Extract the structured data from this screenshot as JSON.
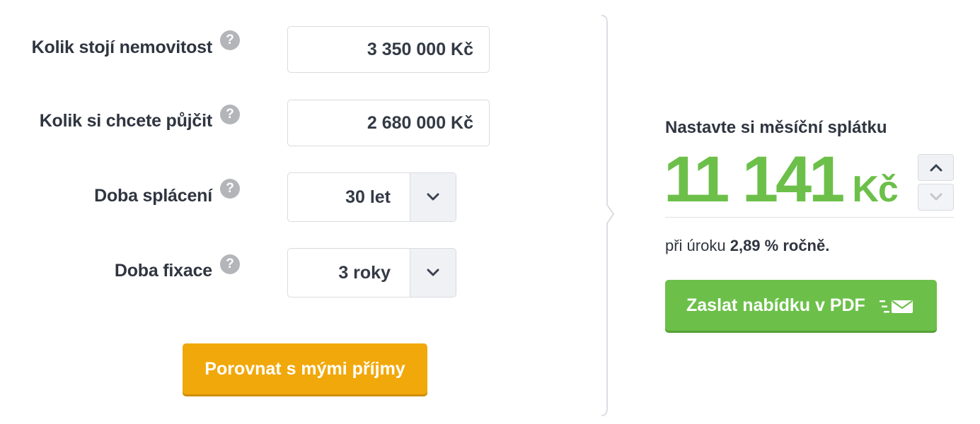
{
  "form": {
    "price": {
      "label": "Kolik stojí nemovitost",
      "help": "?",
      "value": "3 350 000 Kč"
    },
    "loan": {
      "label": "Kolik si chcete půjčit",
      "help": "?",
      "value": "2 680 000 Kč"
    },
    "term": {
      "label": "Doba splácení",
      "help": "?",
      "value": "30 let"
    },
    "fixation": {
      "label": "Doba fixace",
      "help": "?",
      "value": "3 roky"
    },
    "compare_label": "Porovnat s mými příjmy"
  },
  "result": {
    "title": "Nastavte si měsíční splátku",
    "amount": "11 141",
    "currency": "Kč",
    "rate_prefix": "při úroku",
    "rate_value": "2,89 % ročně.",
    "pdf_label": "Zaslat nabídku v PDF"
  },
  "icons": {
    "help": "question-mark-icon",
    "dropdown": "chevron-down-icon",
    "increase": "chevron-up-icon",
    "decrease": "chevron-down-icon",
    "pdf": "envelope-send-icon"
  },
  "colors": {
    "accent_green": "#6cc04a",
    "accent_orange": "#f1a80b",
    "text_dark": "#2f3540",
    "help_gray": "#b3b5b9"
  }
}
